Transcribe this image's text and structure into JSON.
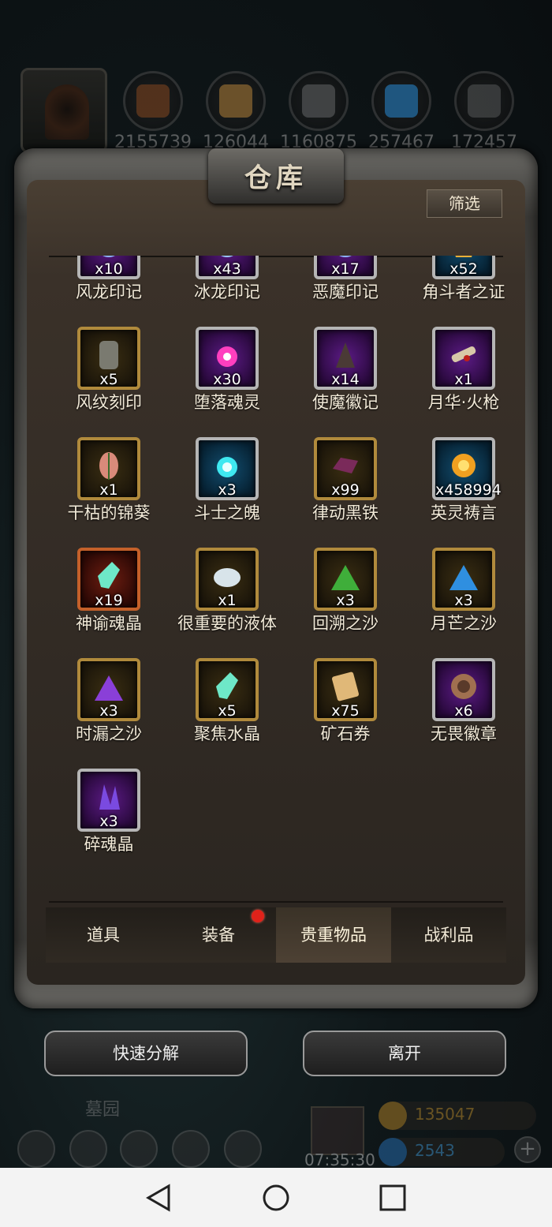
{
  "resources": [
    {
      "name": "resource-1",
      "count": "2155739",
      "color": "#8a4a22"
    },
    {
      "name": "resource-2",
      "count": "126044",
      "color": "#b8843c"
    },
    {
      "name": "resource-3",
      "count": "1160875",
      "color": "#6a6a6a"
    },
    {
      "name": "resource-4",
      "count": "257467",
      "color": "#2f8fd8"
    },
    {
      "name": "resource-5",
      "count": "172457",
      "color": "#5c5c5c"
    }
  ],
  "warehouse": {
    "title": "仓库",
    "filter_label": "筛选",
    "items": [
      {
        "name": "风龙印记",
        "qty": "x10",
        "frame": "purple",
        "icon": "swirl-icon",
        "color": "#8fb6ff"
      },
      {
        "name": "冰龙印记",
        "qty": "x43",
        "frame": "purple",
        "icon": "swirl-icon",
        "color": "#9cc9ff"
      },
      {
        "name": "恶魔印记",
        "qty": "x17",
        "frame": "purple",
        "icon": "swirl-icon",
        "color": "#8fb6ff"
      },
      {
        "name": "角斗者之证",
        "qty": "x52",
        "frame": "blue",
        "icon": "crest-icon",
        "color": "#e8b03a"
      },
      {
        "name": "风纹刻印",
        "qty": "x5",
        "frame": "gold",
        "icon": "tablet-icon",
        "color": "#7a7a70"
      },
      {
        "name": "堕落魂灵",
        "qty": "x30",
        "frame": "purple",
        "icon": "soul-orb-icon",
        "color": "#ff3fbf"
      },
      {
        "name": "使魔徽记",
        "qty": "x14",
        "frame": "purple",
        "icon": "claw-icon",
        "color": "#4a3a36"
      },
      {
        "name": "月华·火枪",
        "qty": "x1",
        "frame": "purple",
        "icon": "gun-icon",
        "color": "#d8c8a8"
      },
      {
        "name": "干枯的锦葵",
        "qty": "x1",
        "frame": "gold",
        "icon": "leaf-icon",
        "color": "#d98a7a"
      },
      {
        "name": "斗士之魄",
        "qty": "x3",
        "frame": "blue",
        "icon": "spirit-orb-icon",
        "color": "#3fe8f0"
      },
      {
        "name": "律动黑铁",
        "qty": "x99",
        "frame": "gold",
        "icon": "ingot-icon",
        "color": "#7a2a5a"
      },
      {
        "name": "英灵祷言",
        "qty": "x458994",
        "frame": "blue",
        "icon": "sun-orb-icon",
        "color": "#f0a020"
      },
      {
        "name": "神谕魂晶",
        "qty": "x19",
        "frame": "red",
        "icon": "crystal-icon",
        "color": "#6ee8c8"
      },
      {
        "name": "很重要的液体",
        "qty": "x1",
        "frame": "gold",
        "icon": "liquid-icon",
        "color": "#d8e4ea"
      },
      {
        "name": "回溯之沙",
        "qty": "x3",
        "frame": "gold",
        "icon": "sand-icon",
        "color": "#3fae3a"
      },
      {
        "name": "月芒之沙",
        "qty": "x3",
        "frame": "gold",
        "icon": "sand-icon",
        "color": "#2f8fe0"
      },
      {
        "name": "时漏之沙",
        "qty": "x3",
        "frame": "gold",
        "icon": "sand-icon",
        "color": "#8a3fd8"
      },
      {
        "name": "聚焦水晶",
        "qty": "x5",
        "frame": "gold",
        "icon": "crystal-icon",
        "color": "#6ee8c8"
      },
      {
        "name": "矿石券",
        "qty": "x75",
        "frame": "gold",
        "icon": "scroll-icon",
        "color": "#e0b878"
      },
      {
        "name": "无畏徽章",
        "qty": "x6",
        "frame": "purple",
        "icon": "medallion-icon",
        "color": "#a07050"
      },
      {
        "name": "碎魂晶",
        "qty": "x3",
        "frame": "purple",
        "icon": "shard-icon",
        "color": "#7a4ae0"
      }
    ],
    "tabs": [
      {
        "label": "道具",
        "active": false
      },
      {
        "label": "装备",
        "active": false,
        "alert": true
      },
      {
        "label": "贵重物品",
        "active": true
      },
      {
        "label": "战利品",
        "active": false
      }
    ]
  },
  "actions": {
    "decompose_label": "快速分解",
    "leave_label": "离开"
  },
  "hud": {
    "place": "墓园",
    "timer": "07:35:30",
    "gold": "135047",
    "gems": "2543",
    "plus": "+"
  },
  "colors": {
    "accent_gold": "#b08a3c",
    "alert_red": "#e0221a",
    "gold_text": "#d8a030",
    "gem_text": "#4aa8e8"
  }
}
